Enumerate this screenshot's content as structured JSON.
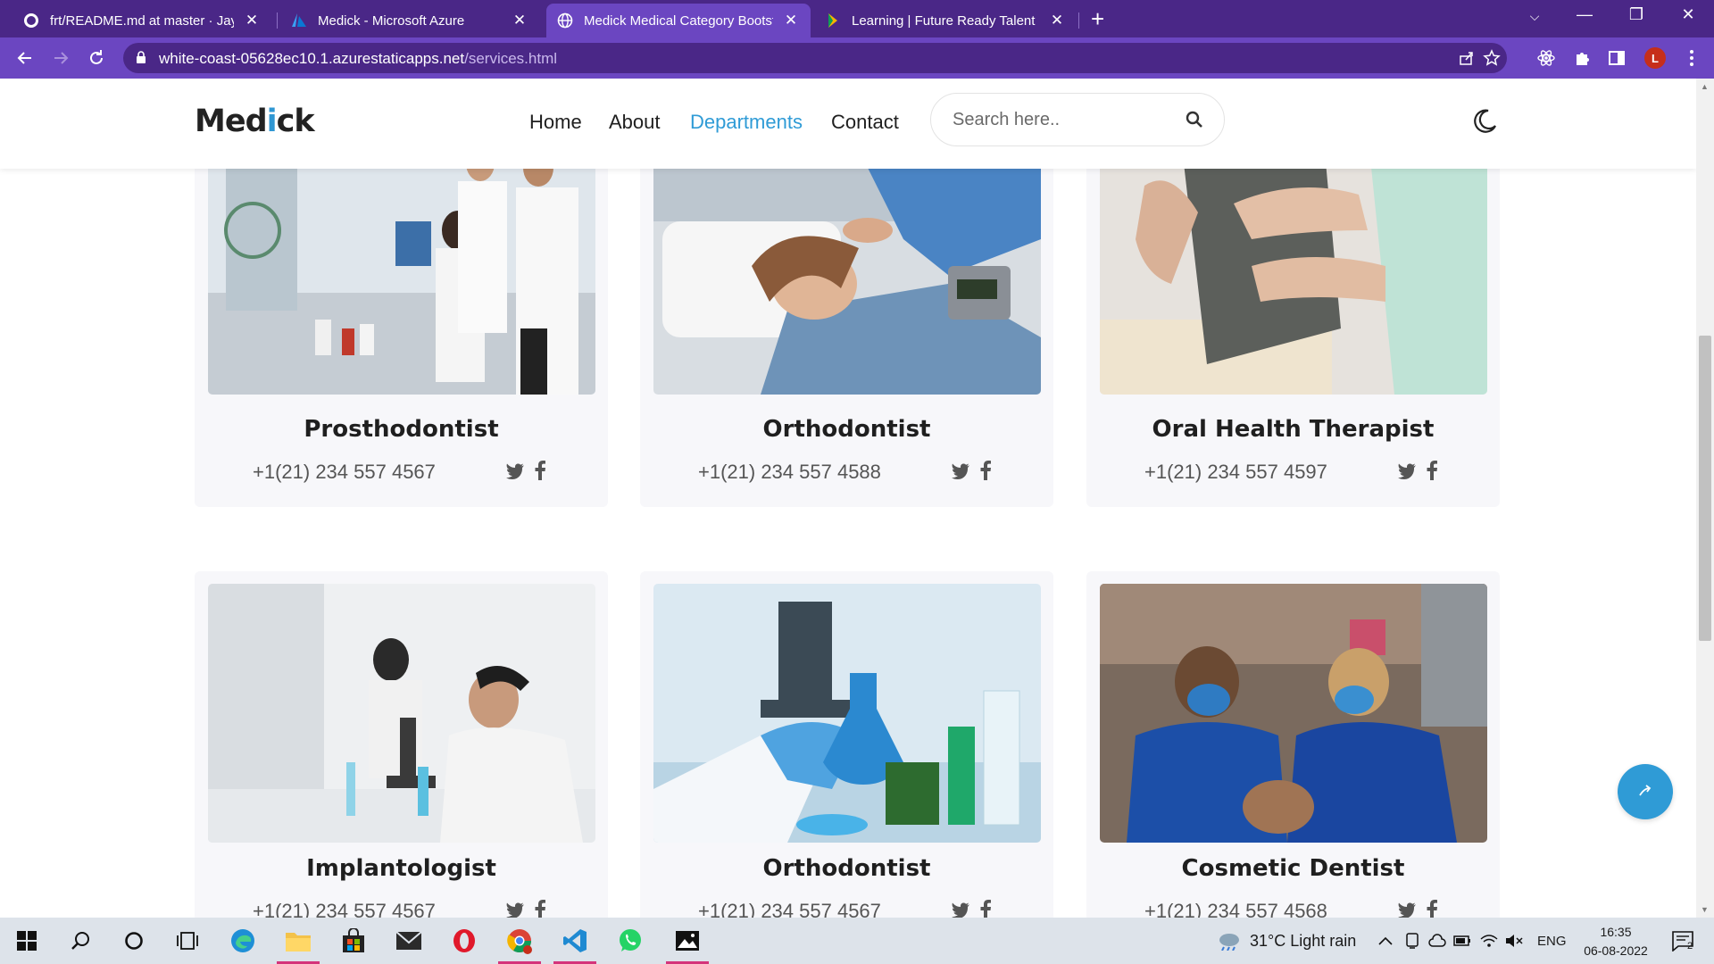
{
  "browser": {
    "tabs": [
      {
        "title": "frt/README.md at master · Jayala",
        "icon": "github-icon"
      },
      {
        "title": "Medick - Microsoft Azure",
        "icon": "azure-icon"
      },
      {
        "title": "Medick Medical Category Bootstr",
        "icon": "globe-icon",
        "active": true
      },
      {
        "title": "Learning | Future Ready Talent",
        "icon": "learning-icon"
      }
    ],
    "url_domain": "white-coast-05628ec10.1.azurestaticapps.net",
    "url_path": "/services.html",
    "profile_initial": "L",
    "theme_color": "#6b46c1"
  },
  "site": {
    "logo_prefix": "Med",
    "logo_accent": "i",
    "logo_suffix": "ck",
    "accent_color": "#2f97d3",
    "nav": [
      "Home",
      "About",
      "Departments",
      "Contact"
    ],
    "active_nav": "Departments",
    "search_placeholder": "Search here.."
  },
  "departments": [
    {
      "name": "Prosthodontist",
      "phone": "+1(21) 234 557 4567",
      "image": "lab-researchers-photo"
    },
    {
      "name": "Orthodontist",
      "phone": "+1(21) 234 557 4588",
      "image": "patient-hospital-bed-photo"
    },
    {
      "name": "Oral Health Therapist",
      "phone": "+1(21) 234 557 4597",
      "image": "back-examination-photo"
    },
    {
      "name": "Implantologist",
      "phone": "+1(21) 234 557 4567",
      "image": "microscope-scientist-photo"
    },
    {
      "name": "Orthodontist",
      "phone": "+1(21) 234 557 4567",
      "image": "lab-flask-photo"
    },
    {
      "name": "Cosmetic Dentist",
      "phone": "+1(21) 234 557 4568",
      "image": "dentists-at-work-photo"
    }
  ],
  "taskbar": {
    "weather": "31°C  Light rain",
    "language": "ENG",
    "time": "16:35",
    "date": "06-08-2022",
    "notifications": "2"
  }
}
